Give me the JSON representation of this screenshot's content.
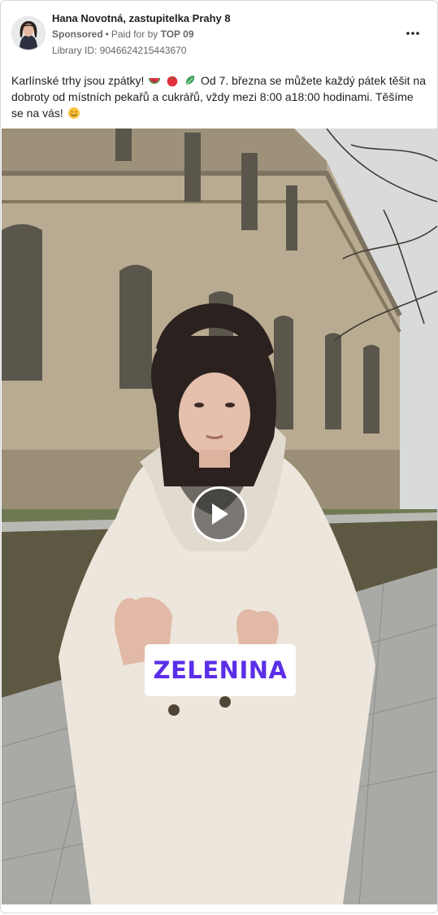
{
  "ad": {
    "page_name": "Hana Novotná, zastupitelka Prahy 8",
    "sponsored_label": "Sponsored",
    "separator": "•",
    "paid_for_prefix": "Paid for by",
    "funder": "TOP 09",
    "library_id": "Library ID: 9046624215443670",
    "more_options_icon": "more-horizontal-icon"
  },
  "post": {
    "text_part1": "Karlínské trhy jsou zpátky!",
    "text_part2": "Od 7. března se můžete každý pátek těšit na dobroty od místních pekařů a cukrářů, vždy mezi 8:00 a18:00 hodinami. Těšíme se na vás!",
    "emojis": [
      "watermelon-emoji",
      "tomato-emoji",
      "leafy-green-emoji",
      "smiling-face-emoji"
    ]
  },
  "video": {
    "caption": "ZELENINA",
    "play_icon": "play-icon",
    "colors": {
      "caption_text": "#5b2ee8",
      "play_overlay": "rgba(40,40,40,0.55)"
    }
  }
}
